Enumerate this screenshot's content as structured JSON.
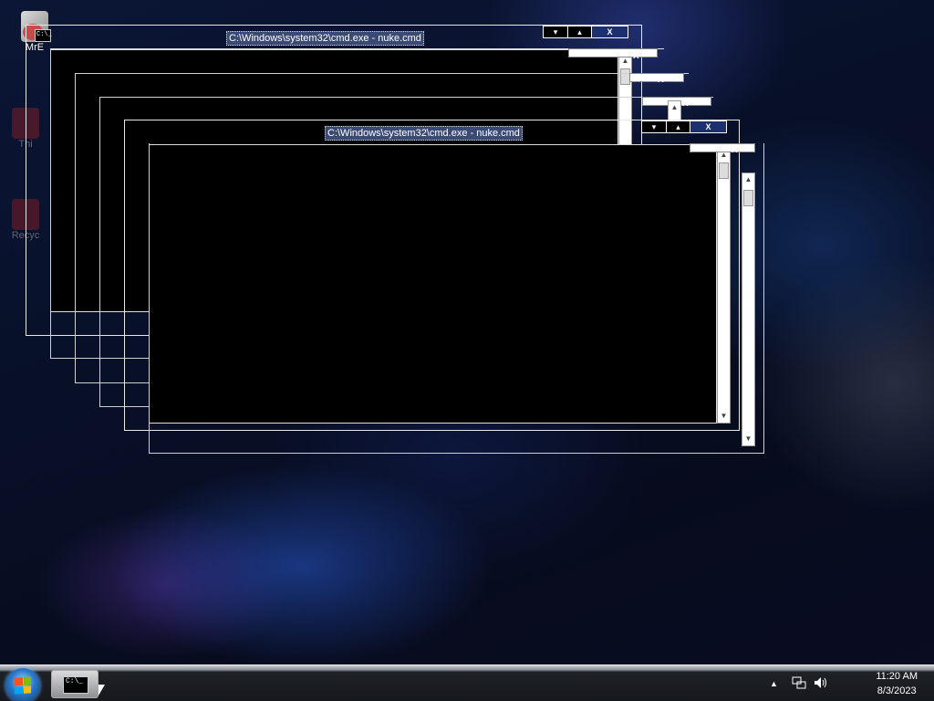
{
  "desktop": {
    "icons": [
      {
        "label": "MrE"
      },
      {
        "label": "Thi"
      },
      {
        "label": "Recyc"
      }
    ]
  },
  "windows": {
    "back": {
      "title": "C:\\Windows\\system32\\cmd.exe - nuke.cmd",
      "minimize": "▾",
      "maximize": "▴",
      "close": "X"
    },
    "front": {
      "title": "C:\\Windows\\system32\\cmd.exe - nuke.cmd",
      "minimize": "▾",
      "maximize": "▴",
      "close": "X"
    },
    "close_glyph": "X",
    "scroll_up": "▲",
    "scroll_down": "▼",
    "icon_text": "C:\\_"
  },
  "taskbar": {
    "task_icon_text": "C:\\_",
    "tray_arrow": "▲",
    "network_icon": "network-icon",
    "volume_icon": "volume-icon",
    "time": "11:20 AM",
    "date": "8/3/2023"
  },
  "colors": {
    "title_highlight": "#3a4a74",
    "close_button": "#1c2f6e",
    "taskbar": "#15181c"
  }
}
